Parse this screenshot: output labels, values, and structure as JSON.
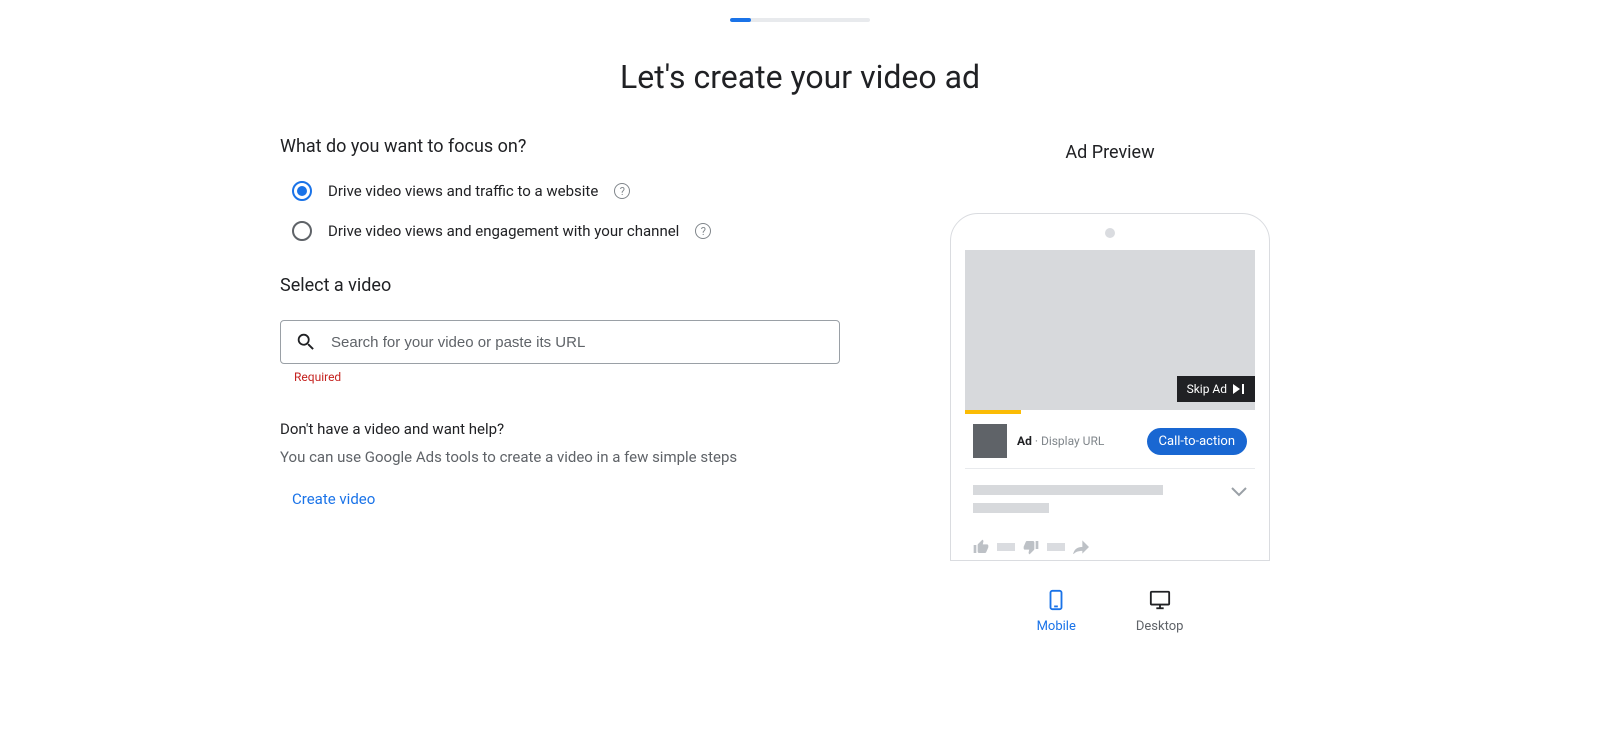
{
  "progress": {
    "percent": 15
  },
  "page_title": "Let's create your video ad",
  "preview": {
    "title": "Ad Preview",
    "skip_label": "Skip Ad",
    "ad_badge": "Ad",
    "display_url_label": "Display URL",
    "cta_label": "Call-to-action",
    "tabs": {
      "mobile": "Mobile",
      "desktop": "Desktop"
    }
  },
  "form": {
    "focus_heading": "What do you want to focus on?",
    "options": [
      {
        "label": "Drive video views and traffic to a website",
        "selected": true
      },
      {
        "label": "Drive video views and engagement with your channel",
        "selected": false
      }
    ],
    "select_video_heading": "Select a video",
    "search_placeholder": "Search for your video or paste its URL",
    "required_label": "Required",
    "help_heading": "Don't have a video and want help?",
    "help_text": "You can use Google Ads tools to create a video in a few simple steps",
    "create_video_link": "Create video"
  }
}
